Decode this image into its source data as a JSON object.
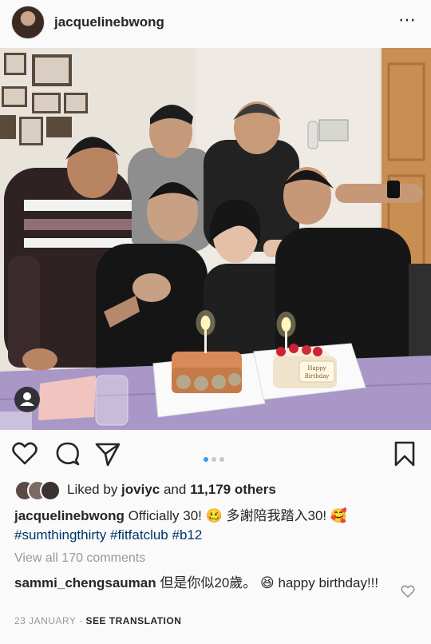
{
  "post": {
    "username": "jacquelinebwong",
    "more_icon": "⋯"
  },
  "carousel": {
    "count": 3,
    "active_index": 0
  },
  "cake": {
    "message_line1": "Happy",
    "message_line2": "Birthday"
  },
  "likes": {
    "prefix": "Liked by ",
    "user": "joviyc",
    "middle": " and ",
    "count": "11,179 others"
  },
  "caption": {
    "username": "jacquelinebwong",
    "text": " Officially 30! 🥴 多謝陪我踏入30! 🥰",
    "hashtags": "#sumthingthirty #fitfatclub #b12"
  },
  "comments": {
    "view_all": "View all 170 comments",
    "first_user": "sammi_chengsauman",
    "first_text": " 但是你似20歲。 😆 happy birthday!!!"
  },
  "footer": {
    "date": "23 JANUARY",
    "separator": " · ",
    "see_translation": "SEE TRANSLATION"
  },
  "colors": {
    "accent_blue": "#3897f0",
    "hashtag_blue": "#003569",
    "muted_gray": "#999999",
    "tablecloth": "#a997c7"
  }
}
